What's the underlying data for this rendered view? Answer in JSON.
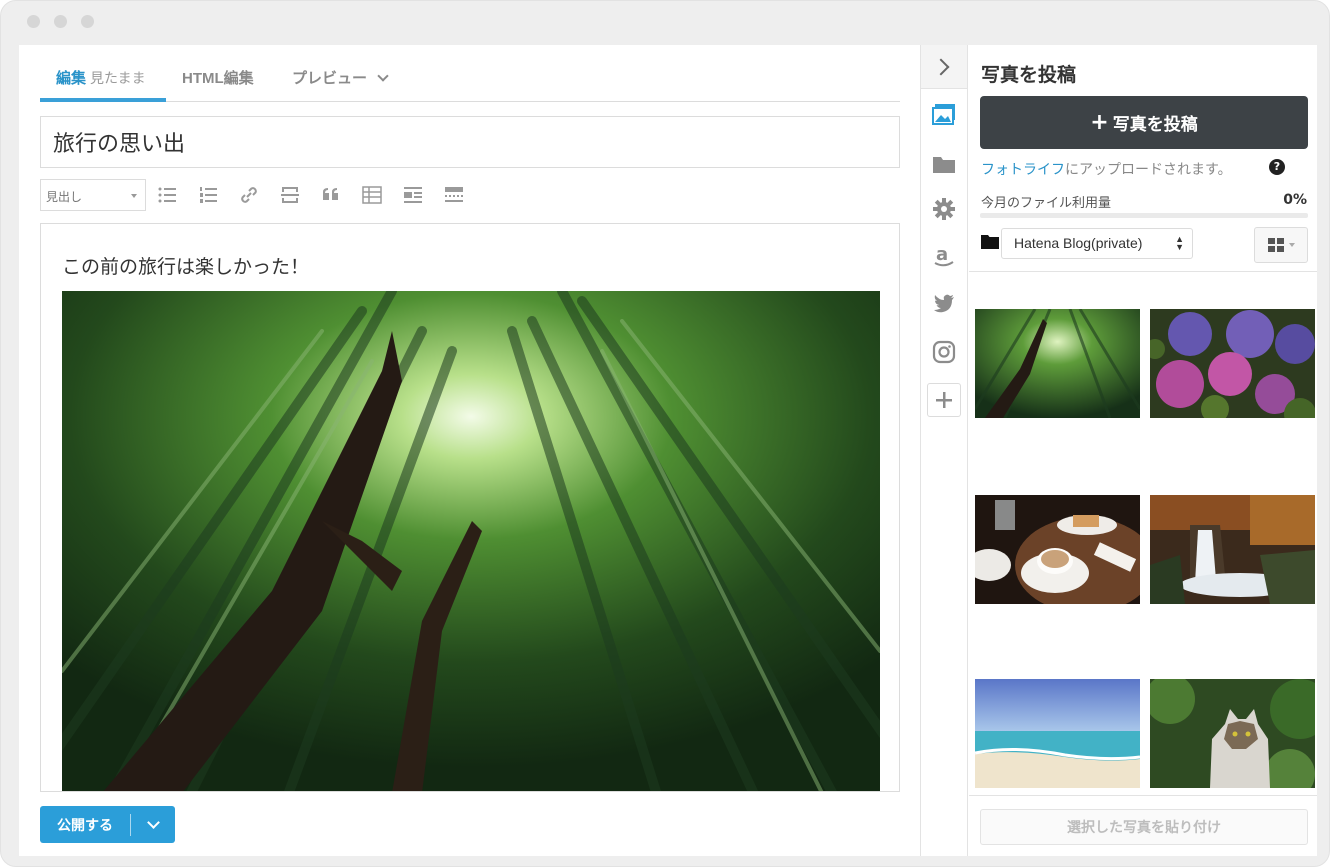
{
  "editor": {
    "tabs": {
      "edit_label": "編集",
      "edit_sub": "見たまま",
      "html_label": "HTML編集",
      "preview_label": "プレビュー"
    },
    "title": "旅行の思い出",
    "heading_select": "見出し",
    "body_text": "この前の旅行は楽しかった！",
    "publish_label": "公開する"
  },
  "panel": {
    "title": "写真を投稿",
    "post_button": "写真を投稿",
    "upload_link": "フォトライフ",
    "upload_note": "にアップロードされます。",
    "usage_label": "今月のファイル利用量",
    "usage_percent": "0%",
    "usage_value": 0,
    "album": "Hatena Blog(private)",
    "paste_button": "選択した写真を貼り付け"
  },
  "colors": {
    "accent": "#2b9ed9",
    "post_button": "#3d4246"
  },
  "icons": [
    "chevron-right-icon",
    "photo-icon",
    "folder-icon",
    "gear-icon",
    "amazon-icon",
    "twitter-icon",
    "instagram-icon",
    "plus-icon"
  ]
}
